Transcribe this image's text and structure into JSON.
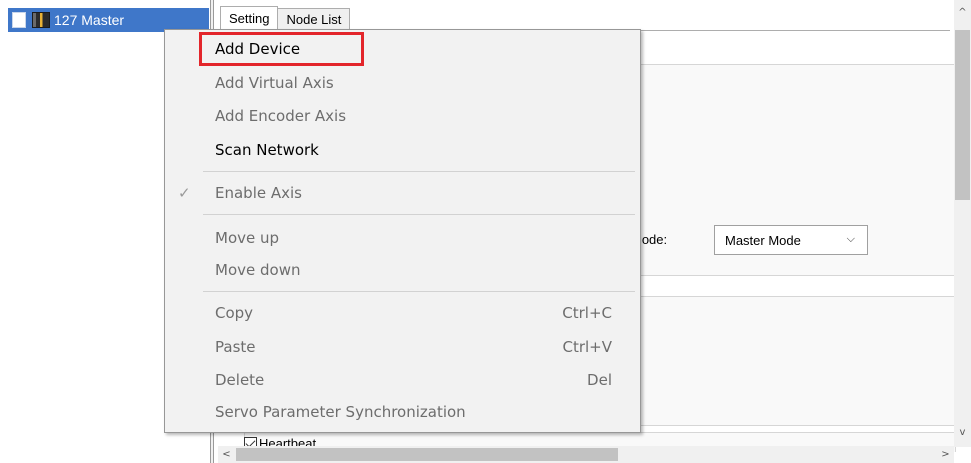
{
  "tree": {
    "node_label": "127 Master"
  },
  "tabs": [
    {
      "label": "Setting",
      "active": true
    },
    {
      "label": "Node List",
      "active": false
    }
  ],
  "settings": {
    "mode_label": "Mode:",
    "mode_value": "Master Mode",
    "heartbeat_label": "Heartbeat",
    "heartbeat_checked": true
  },
  "context_menu": {
    "items": [
      {
        "label": "Add Device",
        "enabled": true,
        "highlighted": true
      },
      {
        "label": "Add Virtual Axis",
        "enabled": false
      },
      {
        "label": "Add Encoder Axis",
        "enabled": false
      },
      {
        "label": "Scan Network",
        "enabled": true
      },
      {
        "label": "Enable Axis",
        "enabled": false,
        "checked": true
      },
      {
        "label": "Move up",
        "enabled": false
      },
      {
        "label": "Move down",
        "enabled": false
      },
      {
        "label": "Copy",
        "enabled": false,
        "shortcut": "Ctrl+C"
      },
      {
        "label": "Paste",
        "enabled": false,
        "shortcut": "Ctrl+V"
      },
      {
        "label": "Delete",
        "enabled": false,
        "shortcut": "Del"
      },
      {
        "label": "Servo Parameter Synchronization",
        "enabled": false
      }
    ],
    "highlight_color": "#e3262b"
  },
  "colors": {
    "selection_bg": "#3f77c9",
    "menu_bg": "#f2f2f2"
  },
  "icons": {
    "check": "✓",
    "chevron_down": "⌵",
    "scroll_up": "^",
    "scroll_down": "v",
    "scroll_left": "<",
    "scroll_right": ">"
  }
}
